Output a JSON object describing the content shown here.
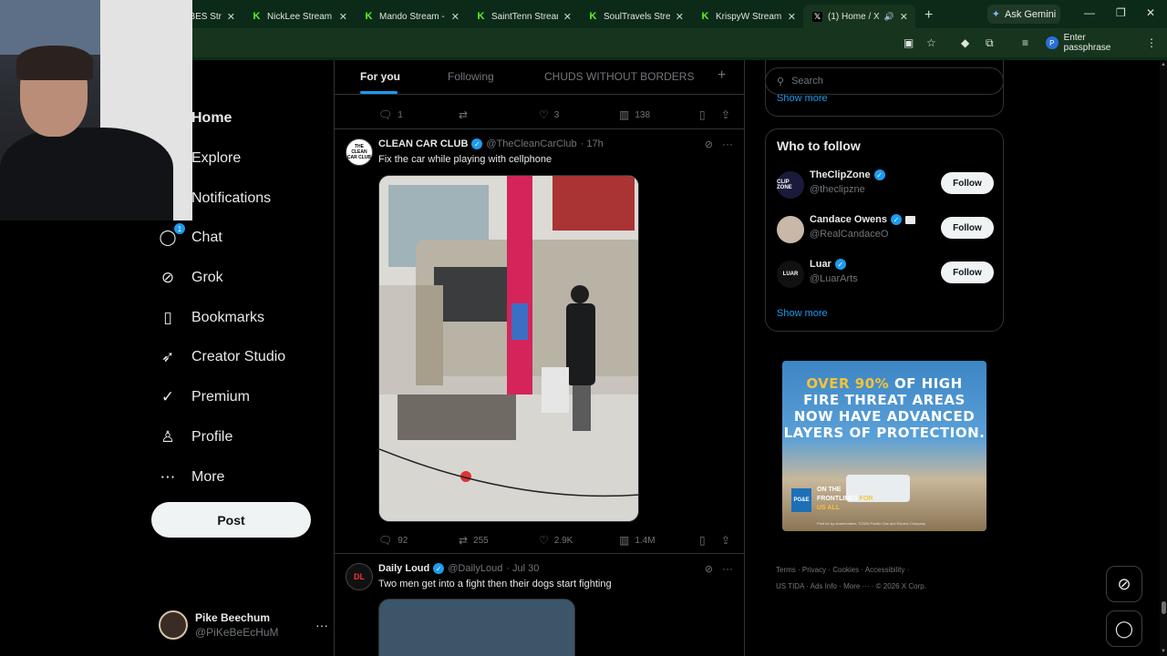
{
  "browser": {
    "tabs": [
      {
        "label": "VIBES Str",
        "favicon": "kick"
      },
      {
        "label": "NickLee Stream -",
        "favicon": "kick"
      },
      {
        "label": "Mando Stream - \\",
        "favicon": "kick"
      },
      {
        "label": "SaintTenn Stream",
        "favicon": "kick"
      },
      {
        "label": "SoulTravels Strea",
        "favicon": "kick"
      },
      {
        "label": "KrispyW Stream -",
        "favicon": "kick"
      },
      {
        "label": "(1) Home / X",
        "favicon": "x",
        "active": true
      }
    ],
    "new_tab": "+",
    "gemini_label": "Ask Gemini",
    "passphrase_label": "Enter passphrase",
    "passphrase_avatar": "P"
  },
  "nav": {
    "items": [
      {
        "label": "Home",
        "icon": "home-icon",
        "glyph": "⌂"
      },
      {
        "label": "Explore",
        "icon": "search-icon",
        "glyph": "⚲"
      },
      {
        "label": "Notifications",
        "icon": "bell-icon",
        "glyph": "🔔"
      },
      {
        "label": "Chat",
        "icon": "chat-icon",
        "glyph": "◯",
        "badge": "1"
      },
      {
        "label": "Grok",
        "icon": "grok-icon",
        "glyph": "⊘"
      },
      {
        "label": "Bookmarks",
        "icon": "bookmark-icon",
        "glyph": "▯"
      },
      {
        "label": "Creator Studio",
        "icon": "rocket-icon",
        "glyph": "➶"
      },
      {
        "label": "Premium",
        "icon": "premium-icon",
        "glyph": "✓"
      },
      {
        "label": "Profile",
        "icon": "person-icon",
        "glyph": "♙"
      },
      {
        "label": "More",
        "icon": "more-circle-icon",
        "glyph": "⋯"
      }
    ],
    "post_label": "Post",
    "account": {
      "name": "Pike Beechum",
      "handle": "@PiKeBeEcHuM",
      "menu": "···"
    }
  },
  "timeline": {
    "tabs": [
      "For you",
      "Following",
      "CHUDS WITHOUT BORDERS"
    ],
    "add_tab": "+",
    "prev_actions": {
      "replies": "1",
      "reposts": "",
      "likes": "3",
      "views": "138"
    },
    "tweets": [
      {
        "name": "CLEAN CAR CLUB",
        "handle": "@TheCleanCarClub",
        "time": "· 17h",
        "text": "Fix the car while playing with cellphone",
        "avatar_text": "THE CLEAN CAR CLUB",
        "actions": {
          "replies": "92",
          "reposts": "255",
          "likes": "2.9K",
          "views": "1.4M"
        }
      },
      {
        "name": "Daily Loud",
        "handle": "@DailyLoud",
        "time": "· Jul 30",
        "text": "Two men get into a fight then their dogs start fighting",
        "avatar_text": "DL"
      }
    ]
  },
  "right": {
    "search_placeholder": "Search",
    "show_more_top": "Show more",
    "who_to_follow": {
      "title": "Who to follow",
      "accounts": [
        {
          "name": "TheClipZone",
          "handle": "@theclipzne",
          "button": "Follow",
          "avatar_text": "CLIP ZONE",
          "avatar_color": "#1a1a3a"
        },
        {
          "name": "Candace Owens",
          "handle": "@RealCandaceO",
          "button": "Follow",
          "avatar_text": "",
          "avatar_color": "#c9b8a8"
        },
        {
          "name": "Luar",
          "handle": "@LuarArts",
          "button": "Follow",
          "avatar_text": "LUAR",
          "avatar_color": "#111111"
        }
      ],
      "show_more": "Show more"
    },
    "ad": {
      "line1_highlight": "OVER 90%",
      "line1_rest": " OF HIGH",
      "line2": "FIRE THREAT AREAS",
      "line3": "NOW HAVE ADVANCED",
      "line4": "LAYERS OF PROTECTION.",
      "logo": "PG&E",
      "sub1": "ON THE",
      "sub2": "FRONTLINES",
      "sub2_highlight": " FOR",
      "sub3": "US ALL",
      "fine": "Paid for by shareholders. ©2026 Pacific Gas and Electric Company"
    },
    "footer": {
      "line1": "Terms  ·  Privacy  ·  Cookies  ·  Accessibility  ·",
      "line2": "US TIDA  ·  Ads Info  ·  More ···  ·  © 2026 X Corp."
    }
  }
}
